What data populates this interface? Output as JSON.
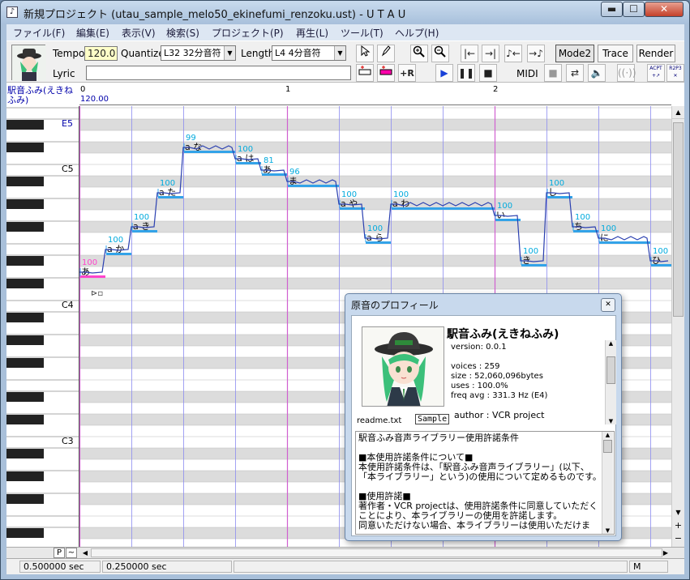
{
  "window": {
    "title": "新規プロジェクト (utau_sample_melo50_ekinefumi_renzoku.ust) - U T A U",
    "buttons": {
      "minimize": "▬",
      "maximize": "☐",
      "close": "✕"
    }
  },
  "menu": [
    "ファイル(F)",
    "編集(E)",
    "表示(V)",
    "検索(S)",
    "プロジェクト(P)",
    "再生(L)",
    "ツール(T)",
    "ヘルプ(H)"
  ],
  "toolbar": {
    "tempo_label": "Tempo",
    "tempo_value": "120.0",
    "quantize_label": "Quantize",
    "quantize_value": "L32 32分音符",
    "length_label": "Length",
    "length_value": "L4  4分音符",
    "lyric_label": "Lyric",
    "midi_label": "MIDI",
    "mode2_label": "Mode2",
    "trace_label": "Trace",
    "render_label": "Render",
    "acpt_label": "ACPT",
    "r2p3_label": "R2P3"
  },
  "editor": {
    "singer_name": "駅音ふみ(えきねふみ)",
    "ruler": {
      "start": "0",
      "tempo": "120.00",
      "measure1": "1",
      "measure2": "2"
    },
    "octave_labels": [
      "E5",
      "C5",
      "C4",
      "C3"
    ],
    "notes": [
      {
        "lyric": "あ",
        "velocity": "100"
      },
      {
        "lyric": "a か",
        "velocity": "100"
      },
      {
        "lyric": "a き",
        "velocity": "100"
      },
      {
        "lyric": "a た",
        "velocity": "100"
      },
      {
        "lyric": "a な",
        "velocity": "99"
      },
      {
        "lyric": "a は",
        "velocity": "100"
      },
      {
        "lyric": "あ",
        "velocity": "81"
      },
      {
        "lyric": "ま",
        "velocity": "96"
      },
      {
        "lyric": "a や",
        "velocity": "100"
      },
      {
        "lyric": "a ら",
        "velocity": "100"
      },
      {
        "lyric": "a わ",
        "velocity": "100"
      },
      {
        "lyric": "い",
        "velocity": "100"
      },
      {
        "lyric": "き",
        "velocity": "100"
      },
      {
        "lyric": "し",
        "velocity": "100"
      },
      {
        "lyric": "ち",
        "velocity": "100"
      },
      {
        "lyric": "に",
        "velocity": "100"
      },
      {
        "lyric": "ひ",
        "velocity": "100"
      }
    ],
    "hscroll": {
      "p_label": "P",
      "tilde_label": "~"
    }
  },
  "status": {
    "cell1": "0.500000 sec",
    "cell2": "0.250000 sec",
    "cell3": "M"
  },
  "dialog": {
    "title": "原音のプロフィール",
    "singer_name": "駅音ふみ(えきねふみ)",
    "version": "version: 0.0.1",
    "voices": "voices : 259",
    "size": "size : 52,060,096bytes",
    "uses": "uses : 100.0%",
    "freq": "freq avg : 331.3 Hz (E4)",
    "readme": "readme.txt",
    "sample": "Sample",
    "author": "author : VCR project",
    "license": [
      "駅音ふみ音声ライブラリー使用許諾条件",
      "",
      "■本使用許諾条件について■",
      "本使用許諾条件は、「駅音ふみ音声ライブラリー」(以下、",
      "「本ライブラリー」という)の使用について定めるものです。",
      "",
      "■使用許諾■",
      "著作者・VCR projectは、使用許諾条件に同意していただく",
      "ことにより、本ライブラリーの使用を許諾します。",
      "同意いただけない場合、本ライブラリーは使用いただけま"
    ]
  },
  "colors": {
    "note_bar": "#33a3e8",
    "pitch_line": "#2a3fb0",
    "velocity_text": "#00aadd",
    "measure_line": "#d060d0",
    "beat_line": "#8c8cf0",
    "selected_note": "#ff44cc",
    "gray_row": "#dcdcdc",
    "singer_text": "#0000aa"
  }
}
